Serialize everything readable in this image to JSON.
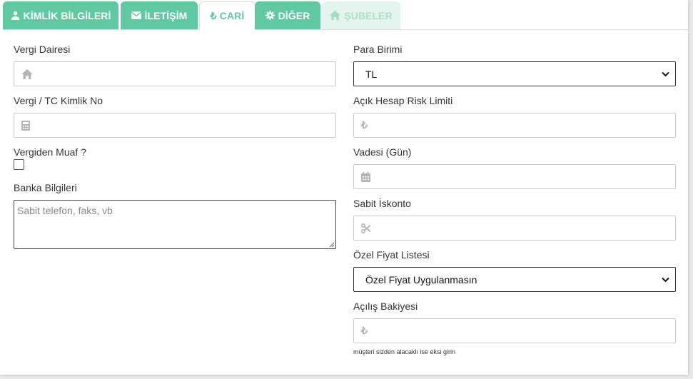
{
  "tabs": [
    {
      "label": "KİMLİK BİLGİLERİ",
      "icon": "user-icon"
    },
    {
      "label": "İLETİŞİM",
      "icon": "envelope-icon"
    },
    {
      "label": "CARİ",
      "icon": "lira-icon"
    },
    {
      "label": "DİĞER",
      "icon": "gear-icon"
    },
    {
      "label": "ŞUBELER",
      "icon": "home-icon"
    }
  ],
  "left": {
    "tax_office": {
      "label": "Vergi Dairesi",
      "value": ""
    },
    "tax_id": {
      "label": "Vergi / TC Kimlik No",
      "value": ""
    },
    "tax_exempt": {
      "label": "Vergiden Muaf ?",
      "checked": false
    },
    "bank_info": {
      "label": "Banka Bilgileri",
      "placeholder": "Sabit telefon, faks, vb"
    }
  },
  "right": {
    "currency": {
      "label": "Para Birimi",
      "value": "TL"
    },
    "risk_limit": {
      "label": "Açık Hesap Risk Limiti",
      "value": ""
    },
    "due_days": {
      "label": "Vadesi (Gün)",
      "value": ""
    },
    "fixed_discount": {
      "label": "Sabit İskonto",
      "value": ""
    },
    "price_list": {
      "label": "Özel Fiyat Listesi",
      "value": "Özel Fiyat Uygulanmasın"
    },
    "opening_balance": {
      "label": "Açılış Bakiyesi",
      "value": "",
      "help": "müşteri sizden alacaklı ise eksi girin"
    }
  },
  "colors": {
    "accent": "#5fc9a1",
    "accent_disabled": "#e3f5ee"
  }
}
